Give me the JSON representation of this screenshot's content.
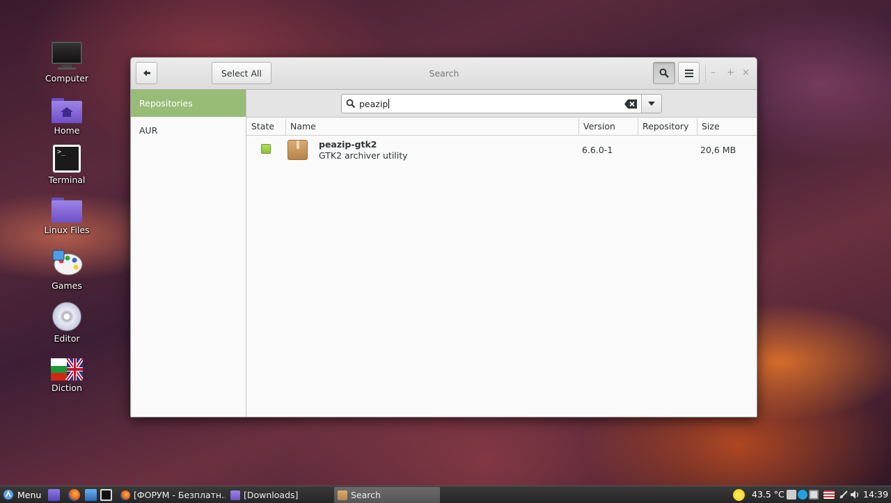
{
  "desktop": {
    "icons": [
      {
        "label": "Computer"
      },
      {
        "label": "Home"
      },
      {
        "label": "Terminal"
      },
      {
        "label": "Linux Files"
      },
      {
        "label": "Games"
      },
      {
        "label": "Editor"
      },
      {
        "label": "Diction"
      }
    ]
  },
  "window": {
    "title": "Search",
    "select_all_label": "Select All",
    "sidebar": [
      {
        "label": "Repositories",
        "active": true
      },
      {
        "label": "AUR",
        "active": false
      }
    ],
    "search": {
      "value": "peazip"
    },
    "columns": [
      "State",
      "Name",
      "Version",
      "Repository",
      "Size"
    ],
    "rows": [
      {
        "name": "peazip-gtk2",
        "description": "GTK2 archiver utility",
        "version": "6.6.0-1",
        "repository": "",
        "size": "20,6 MB",
        "state_color": "#9ccc46"
      }
    ]
  },
  "taskbar": {
    "menu_label": "Menu",
    "tasks": [
      {
        "label": "[ФОРУМ - Безплатн..."
      },
      {
        "label": "[Downloads]"
      },
      {
        "label": "Search"
      }
    ],
    "temperature": "43.5 °C",
    "clock": "14:39"
  },
  "colors": {
    "accent": "#98bb76",
    "taskbar": "#2e2e2e"
  }
}
